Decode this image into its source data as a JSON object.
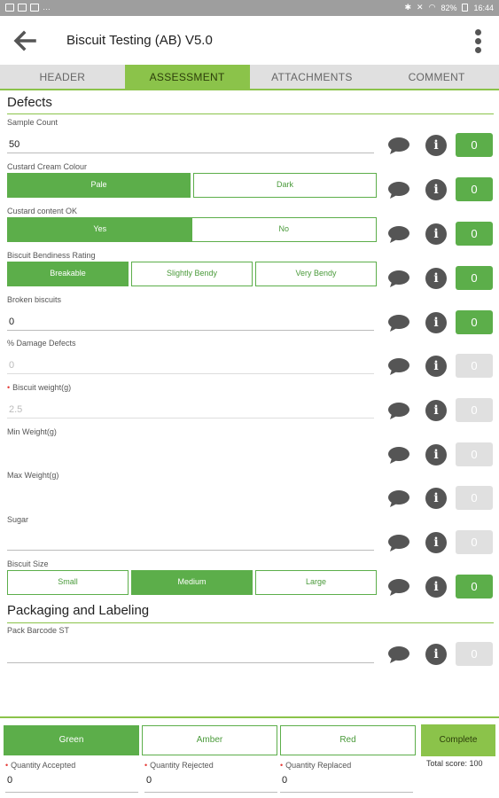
{
  "status_bar": {
    "battery": "82%",
    "time": "16:44"
  },
  "app": {
    "title": "Biscuit Testing (AB) V5.0"
  },
  "tabs": [
    {
      "label": "HEADER",
      "active": false
    },
    {
      "label": "ASSESSMENT",
      "active": true
    },
    {
      "label": "ATTACHMENTS",
      "active": false
    },
    {
      "label": "COMMENT",
      "active": false
    }
  ],
  "sections": {
    "defects": "Defects",
    "packaging": "Packaging and Labeling"
  },
  "questions": {
    "sample_count": {
      "label": "Sample Count",
      "value": "50",
      "score": "0"
    },
    "custard_colour": {
      "label": "Custard Cream Colour",
      "options": [
        "Pale",
        "Dark"
      ],
      "selected": "Pale",
      "score": "0"
    },
    "custard_content": {
      "label": "Custard content OK",
      "options": [
        "Yes",
        "No"
      ],
      "selected": "Yes",
      "score": "0"
    },
    "bendiness": {
      "label": "Biscuit Bendiness Rating",
      "options": [
        "Breakable",
        "Slightly Bendy",
        "Very Bendy"
      ],
      "selected": "Breakable",
      "score": "0"
    },
    "broken": {
      "label": "Broken biscuits",
      "value": "0",
      "score": "0"
    },
    "damage": {
      "label": "% Damage Defects",
      "value": "0",
      "score": "0"
    },
    "weight": {
      "label": "Biscuit weight(g)",
      "value": "2.5",
      "score": "0",
      "required": true
    },
    "min_weight": {
      "label": "Min Weight(g)",
      "value": "",
      "score": "0"
    },
    "max_weight": {
      "label": "Max Weight(g)",
      "value": "",
      "score": "0"
    },
    "sugar": {
      "label": "Sugar",
      "value": "",
      "score": "0"
    },
    "size": {
      "label": "Biscuit Size",
      "options": [
        "Small",
        "Medium",
        "Large"
      ],
      "selected": "Medium",
      "score": "0"
    },
    "barcode": {
      "label": "Pack Barcode ST",
      "value": "",
      "score": "0"
    }
  },
  "bottom": {
    "result_options": [
      "Green",
      "Amber",
      "Red"
    ],
    "selected": "Green",
    "complete_label": "Complete",
    "total_score": "Total score: 100",
    "quantities": [
      {
        "label": "Quantity Accepted",
        "value": "0"
      },
      {
        "label": "Quantity Rejected",
        "value": "0"
      },
      {
        "label": "Quantity Replaced",
        "value": "0"
      }
    ]
  },
  "colors": {
    "accent": "#8bc34a",
    "selected": "#5cae4a",
    "disabled": "#e0e0e0"
  }
}
